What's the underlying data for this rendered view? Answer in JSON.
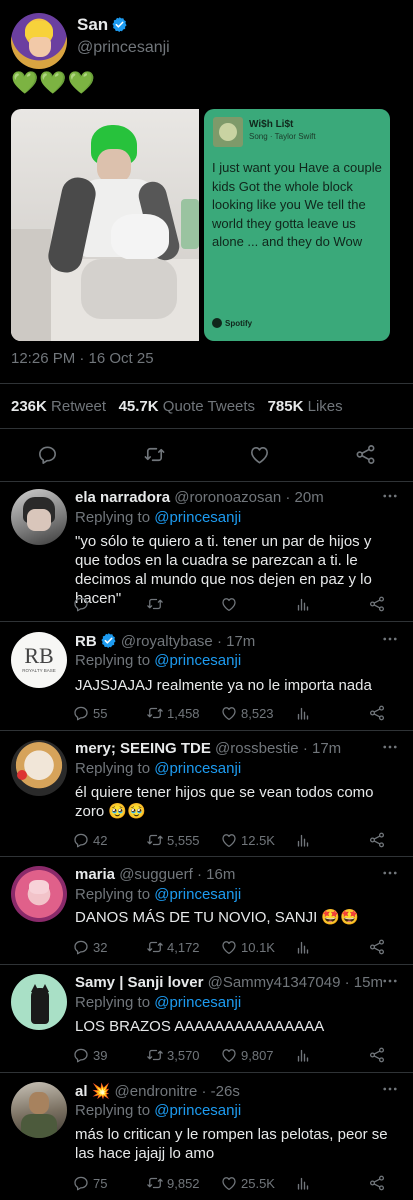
{
  "author": {
    "name": "San",
    "handle": "@princesanji"
  },
  "tweet": {
    "text": "💚💚💚",
    "time": "12:26 PM · 16 Oct 25"
  },
  "spotify": {
    "song_title": "Wi$h Li$t",
    "song_meta": "Song · Taylor Swift",
    "lyrics": "I just want you Have a couple kids Got the whole block looking like you We tell the world they gotta leave us alone ... and they do Wow",
    "brand": "Spotify"
  },
  "stats": {
    "retweets": "236K",
    "retweets_label": "Retweet",
    "quotes": "45.7K",
    "quotes_label": "Quote Tweets",
    "likes": "785K",
    "likes_label": "Likes"
  },
  "colors": {
    "accent": "#1d9bf0",
    "background": "#000000",
    "spotify_green": "#3aa97a"
  },
  "replies": [
    {
      "name": "ela narradora",
      "handle": "@roronoazosan",
      "time": "· 20m",
      "replying_label": "Replying to",
      "replying_to": "@princesanji",
      "text": "\"yo sólo te quiero a ti. tener un par de hijos y que todos en la cuadra se parezcan a ti. le decimos al mundo que nos dejen en paz y lo hacen\"",
      "replies": "",
      "retweets": "",
      "likes": ""
    },
    {
      "name": "RB",
      "handle": "@royaltybase",
      "time": "· 17m",
      "replying_label": "Replying to",
      "replying_to": "@princesanji",
      "text": "JAJSJAJAJ realmente ya no le importa nada",
      "replies": "55",
      "retweets": "1,458",
      "likes": "8,523",
      "avatar_text": "RB",
      "avatar_sub": "ROYALTY BASE"
    },
    {
      "name": "mery; SEEING TDE",
      "handle": "@rossbestie",
      "time": "· 17m",
      "replying_label": "Replying to",
      "replying_to": "@princesanji",
      "text": "él quiere tener hijos que se vean todos como zoro 🥹🥹",
      "replies": "42",
      "retweets": "5,555",
      "likes": "12.5K"
    },
    {
      "name": "maria",
      "handle": "@sugguerf",
      "time": "· 16m",
      "replying_label": "Replying to",
      "replying_to": "@princesanji",
      "text": "DANOS MÁS DE TU NOVIO, SANJI 🤩🤩",
      "replies": "32",
      "retweets": "4,172",
      "likes": "10.1K"
    },
    {
      "name": "Samy | Sanji lover",
      "handle": "@Sammy41347049",
      "time": "· 15m",
      "replying_label": "Replying to",
      "replying_to": "@princesanji",
      "text": "LOS BRAZOS AAAAAAAAAAAAAAA",
      "replies": "39",
      "retweets": "3,570",
      "likes": "9,807"
    },
    {
      "name": "al 💥",
      "handle": "@endronitre",
      "time": "· -26s",
      "replying_label": "Replying to",
      "replying_to": "@princesanji",
      "text": "más lo critican y le rompen las pelotas, peor se las hace jajajj lo amo",
      "replies": "75",
      "retweets": "9,852",
      "likes": "25.5K"
    }
  ]
}
